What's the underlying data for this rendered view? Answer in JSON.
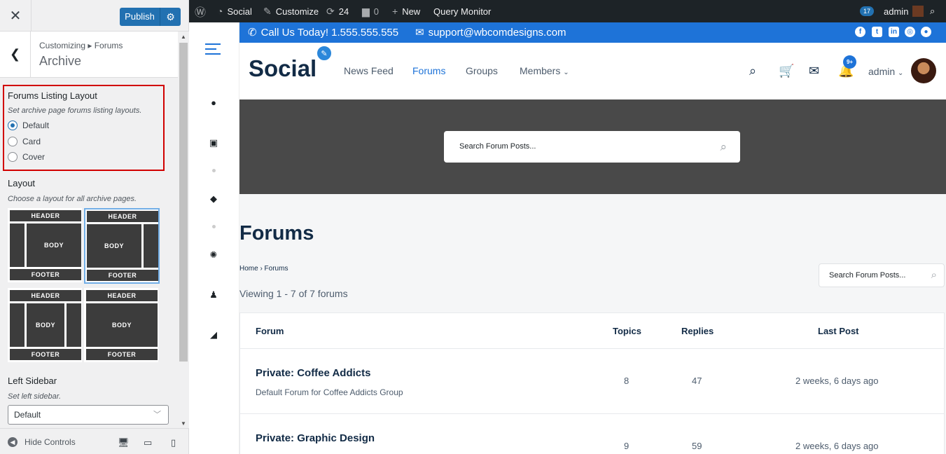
{
  "customizer": {
    "close_icon": "close-icon",
    "publish_label": "Publish",
    "crumb_path": "Customizing ▸ Forums",
    "crumb_title": "Archive",
    "forums_layout": {
      "title": "Forums Listing Layout",
      "desc": "Set archive page forums listing layouts.",
      "options": [
        "Default",
        "Card",
        "Cover"
      ],
      "selected": "Default"
    },
    "layout": {
      "title": "Layout",
      "desc": "Choose a layout for all archive pages.",
      "header": "HEADER",
      "body": "BODY",
      "footer": "FOOTER"
    },
    "left_sidebar": {
      "title": "Left Sidebar",
      "desc": "Set left sidebar.",
      "value": "Default"
    },
    "hide_controls": "Hide Controls",
    "highlight_color": "#d10000",
    "accent_color": "#2271b1"
  },
  "adminbar": {
    "site_name": "Social",
    "customize": "Customize",
    "updates": "24",
    "comments": "0",
    "new": "New",
    "query_monitor": "Query Monitor",
    "badge": "17",
    "user": "admin"
  },
  "topbar": {
    "phone": "Call Us Today! 1.555.555.555",
    "email": "support@wbcomdesigns.com",
    "color": "#1e73d8"
  },
  "header": {
    "logo": "Social",
    "nav": [
      "News Feed",
      "Forums",
      "Groups",
      "Members"
    ],
    "active_nav": "Forums",
    "notif_badge": "9+",
    "user": "admin"
  },
  "hero": {
    "search_placeholder": "Search Forum Posts..."
  },
  "main": {
    "title": "Forums",
    "breadcrumb": "Home › Forums",
    "viewing": "Viewing 1 - 7 of 7 forums",
    "side_search_placeholder": "Search Forum Posts...",
    "columns": [
      "Forum",
      "Topics",
      "Replies",
      "Last Post"
    ],
    "rows": [
      {
        "title": "Private: Coffee Addicts",
        "desc": "Default Forum for Coffee Addicts Group",
        "topics": "8",
        "replies": "47",
        "last": "2 weeks, 6 days ago"
      },
      {
        "title": "Private: Graphic Design",
        "desc": "",
        "topics": "9",
        "replies": "59",
        "last": "2 weeks, 6 days ago"
      }
    ]
  }
}
